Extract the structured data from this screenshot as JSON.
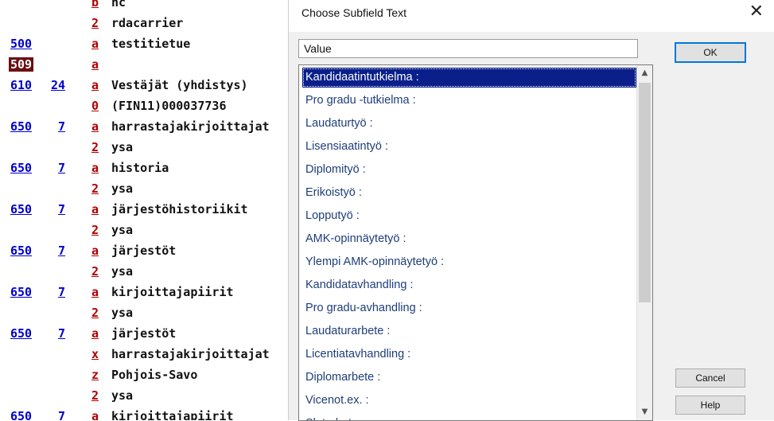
{
  "marc_rows": [
    {
      "tag": "",
      "ind": "",
      "code": "b",
      "value": "nc"
    },
    {
      "tag": "",
      "ind": "",
      "code": "2",
      "value": "rdacarrier"
    },
    {
      "tag": "500",
      "ind": "",
      "code": "a",
      "value": "testitietue"
    },
    {
      "tag": "509",
      "ind": "",
      "code": "a",
      "value": ""
    },
    {
      "tag": "610",
      "ind": "24",
      "code": "a",
      "value": "Vestäjät (yhdistys)"
    },
    {
      "tag": "",
      "ind": "",
      "code": "0",
      "value": "(FIN11)000037736"
    },
    {
      "tag": "650",
      "ind": "7",
      "code": "a",
      "value": "harrastajakirjoittajat"
    },
    {
      "tag": "",
      "ind": "",
      "code": "2",
      "value": "ysa"
    },
    {
      "tag": "650",
      "ind": "7",
      "code": "a",
      "value": "historia"
    },
    {
      "tag": "",
      "ind": "",
      "code": "2",
      "value": "ysa"
    },
    {
      "tag": "650",
      "ind": "7",
      "code": "a",
      "value": "järjestöhistoriikit"
    },
    {
      "tag": "",
      "ind": "",
      "code": "2",
      "value": "ysa"
    },
    {
      "tag": "650",
      "ind": "7",
      "code": "a",
      "value": "järjestöt"
    },
    {
      "tag": "",
      "ind": "",
      "code": "2",
      "value": "ysa"
    },
    {
      "tag": "650",
      "ind": "7",
      "code": "a",
      "value": "kirjoittajapiirit"
    },
    {
      "tag": "",
      "ind": "",
      "code": "2",
      "value": "ysa"
    },
    {
      "tag": "650",
      "ind": "7",
      "code": "a",
      "value": "järjestöt"
    },
    {
      "tag": "",
      "ind": "",
      "code": "x",
      "value": "harrastajakirjoittajat"
    },
    {
      "tag": "",
      "ind": "",
      "code": "z",
      "value": "Pohjois-Savo"
    },
    {
      "tag": "",
      "ind": "",
      "code": "2",
      "value": "ysa"
    },
    {
      "tag": "650",
      "ind": "7",
      "code": "a",
      "value": "kirjoittajapiirit"
    }
  ],
  "highlighted_tag": "509",
  "dialog": {
    "title": "Choose Subfield Text",
    "close_glyph": "✕",
    "column_header": "Value",
    "items": [
      "Kandidaatintutkielma :",
      "Pro gradu -tutkielma :",
      "Laudaturtyö :",
      "Lisensiaatintyö :",
      "Diplomityö :",
      "Erikoistyö :",
      "Lopputyö :",
      "AMK-opinnäytetyö :",
      "Ylempi AMK-opinnäytetyö :",
      "Kandidatavhandling :",
      "Pro gradu-avhandling :",
      "Laudaturarbete :",
      "Licentiatavhandling :",
      "Diplomarbete :",
      "Vicenot.ex. :",
      "Slutarbete :"
    ],
    "selected_index": 0,
    "buttons": {
      "ok": "OK",
      "cancel": "Cancel",
      "help": "Help"
    },
    "scroll": {
      "up": "▲",
      "down": "▼"
    }
  },
  "colors": {
    "selection": "#0a1f8a",
    "tag_blue": "#0000cc",
    "code_red": "#b00000",
    "highlight": "#6b0f12"
  }
}
